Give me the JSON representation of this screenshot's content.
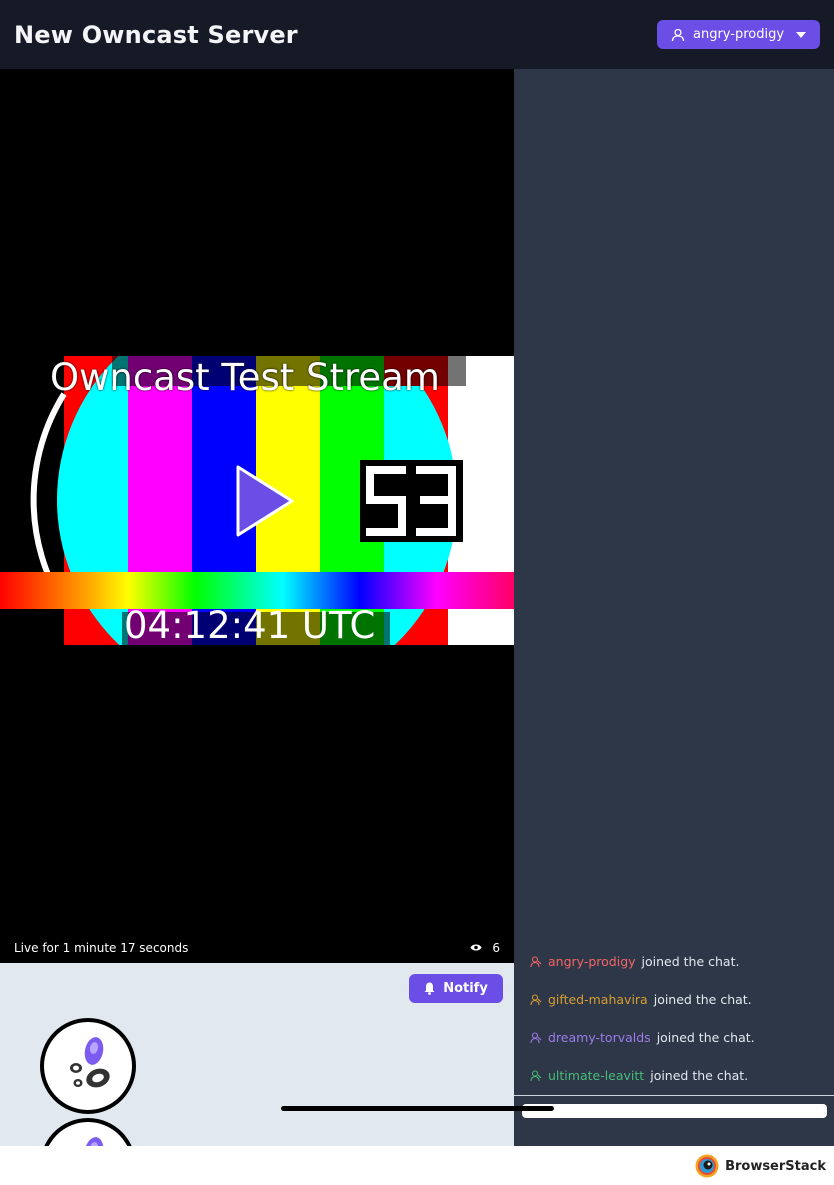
{
  "header": {
    "title": "New Owncast Server",
    "user_label": "angry-prodigy"
  },
  "video": {
    "stream_title": "Owncast Test Stream",
    "clock": "04:12:41 UTC",
    "counter": "53",
    "live_status": "Live for 1 minute 17 seconds",
    "viewer_count": "6"
  },
  "info": {
    "notify_label": "Notify"
  },
  "chat": {
    "messages": [
      {
        "user": "angry-prodigy",
        "text": "joined the chat.",
        "color": "#f56565"
      },
      {
        "user": "gifted-mahavira",
        "text": "joined the chat.",
        "color": "#d69e2e"
      },
      {
        "user": "dreamy-torvalds",
        "text": "joined the chat.",
        "color": "#9f7aea"
      },
      {
        "user": "ultimate-leavitt",
        "text": "joined the chat.",
        "color": "#48bb78"
      }
    ]
  },
  "footer": {
    "brand": "BrowserStack"
  },
  "colors": {
    "accent": "#6a4ee6",
    "header_bg": "#161a26",
    "chat_bg": "#2d3748"
  }
}
